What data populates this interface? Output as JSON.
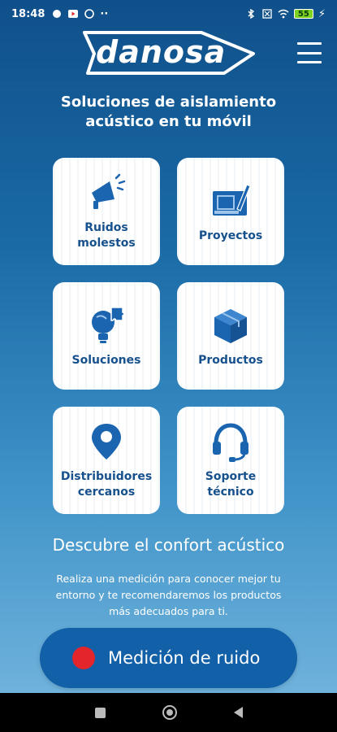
{
  "status_bar": {
    "time": "18:48",
    "battery": "55"
  },
  "header": {
    "logo_text": "danosa",
    "headline": "Soluciones de aislamiento acústico en tu móvil"
  },
  "tiles": [
    {
      "label": "Ruidos molestos",
      "icon": "megaphone-icon"
    },
    {
      "label": "Proyectos",
      "icon": "blueprint-icon"
    },
    {
      "label": "Soluciones",
      "icon": "lightbulb-puzzle-icon"
    },
    {
      "label": "Productos",
      "icon": "box-icon"
    },
    {
      "label": "Distribuidores cercanos",
      "icon": "location-pin-icon"
    },
    {
      "label": "Soporte técnico",
      "icon": "headset-icon"
    }
  ],
  "discover": {
    "title": "Descubre el confort acústico",
    "text": "Realiza una medición para conocer mejor tu entorno y te recomendaremos los productos más adecuados para ti."
  },
  "measure_button": {
    "label": "Medición de ruido"
  },
  "colors": {
    "tile_text": "#17518d",
    "icon_blue": "#1b64b0",
    "record_red": "#e4252b",
    "button_blue": "#1260a8"
  }
}
